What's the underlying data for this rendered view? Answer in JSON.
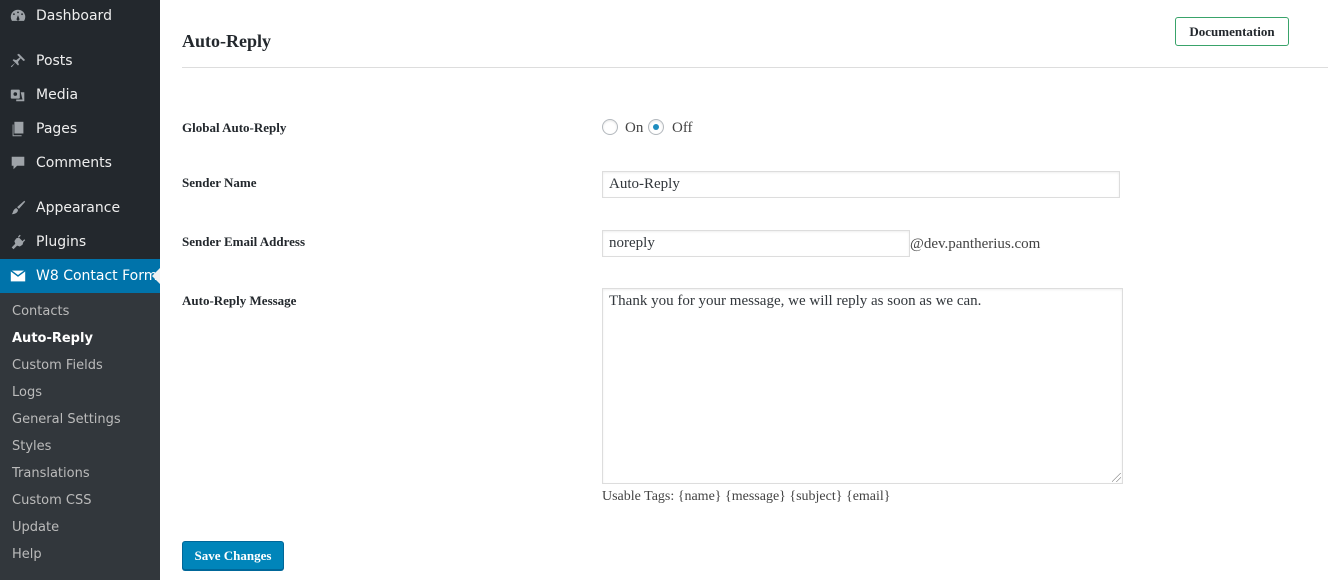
{
  "sidebar": {
    "items": [
      {
        "label": "Dashboard",
        "icon": "dashboard-icon"
      },
      {
        "label": "Posts",
        "icon": "pin-icon"
      },
      {
        "label": "Media",
        "icon": "media-icon"
      },
      {
        "label": "Pages",
        "icon": "pages-icon"
      },
      {
        "label": "Comments",
        "icon": "comment-icon"
      },
      {
        "label": "Appearance",
        "icon": "brush-icon"
      },
      {
        "label": "Plugins",
        "icon": "plug-icon"
      },
      {
        "label": "W8 Contact Form",
        "icon": "envelope-icon"
      }
    ],
    "submenu": [
      "Contacts",
      "Auto-Reply",
      "Custom Fields",
      "Logs",
      "General Settings",
      "Styles",
      "Translations",
      "Custom CSS",
      "Update",
      "Help"
    ]
  },
  "header": {
    "title": "Auto-Reply",
    "doc_button": "Documentation"
  },
  "form": {
    "global_label": "Global Auto-Reply",
    "radio_on": "On",
    "radio_off": "Off",
    "selected": "Off",
    "sender_name_label": "Sender Name",
    "sender_name_value": "Auto-Reply",
    "sender_email_label": "Sender Email Address",
    "sender_email_value": "noreply",
    "email_domain": "@dev.pantherius.com",
    "message_label": "Auto-Reply Message",
    "message_value": "Thank you for your message, we will reply as soon as we can.",
    "usable_tags": "Usable Tags: {name} {message} {subject} {email}",
    "save_button": "Save Changes"
  },
  "colors": {
    "sidebar_bg": "#23282d",
    "submenu_bg": "#32373c",
    "accent": "#0073aa",
    "save_button": "#0085ba",
    "doc_button_border": "#39a36a"
  }
}
